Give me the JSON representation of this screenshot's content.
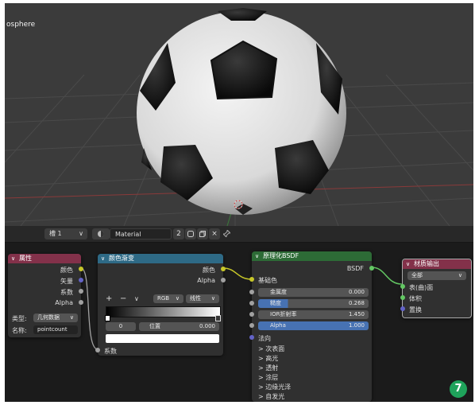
{
  "viewport": {
    "object_label": "osphere"
  },
  "header": {
    "slot": "槽 1",
    "slot_arrow": "∨",
    "material_name": "Material",
    "user_count": "2",
    "copy_icon": "copy-icon",
    "new_icon": "new-icon",
    "close_icon": "×",
    "pin_icon": "pin-icon"
  },
  "nodes": {
    "attribute": {
      "title": "属性",
      "outputs": [
        "颜色",
        "矢量",
        "系数",
        "Alpha"
      ],
      "type_label": "类型:",
      "type_value": "几何数据",
      "name_label": "名称:",
      "name_value": "pointcount"
    },
    "colorramp": {
      "title": "颜色渐变",
      "outputs": [
        "颜色",
        "Alpha"
      ],
      "add": "+",
      "remove": "−",
      "menu": "∨",
      "color_mode": "RGB",
      "interpolation": "线性",
      "index": "0",
      "pos_label": "位置",
      "pos_value": "0.000",
      "input": "系数"
    },
    "bsdf": {
      "title": "原理化BSDF",
      "output": "BSDF",
      "base_color": "基础色",
      "fields": [
        {
          "label": "金属度",
          "value": "0.000"
        },
        {
          "label": "糙度",
          "value": "0.268"
        },
        {
          "label": "IOR折射率",
          "value": "1.450"
        },
        {
          "label": "Alpha",
          "value": "1.000"
        }
      ],
      "normal": "法向",
      "panels": [
        "次表面",
        "高光",
        "透射",
        "涂层",
        "边缘光泽",
        "自发光"
      ]
    },
    "output": {
      "title": "材质输出",
      "target": "全部",
      "inputs": [
        "表(曲)面",
        "体积",
        "置换"
      ]
    }
  },
  "badge": "7",
  "colors": {
    "attribute_header": "#83314a",
    "ramp_header": "#2e6a86",
    "bsdf_header": "#2d6b36",
    "output_header": "#83314a",
    "socket_color": "#c7c729",
    "socket_float": "#a1a1a1",
    "socket_vector": "#6363c7",
    "socket_shader": "#63c763",
    "badge": "#1fa35b"
  }
}
